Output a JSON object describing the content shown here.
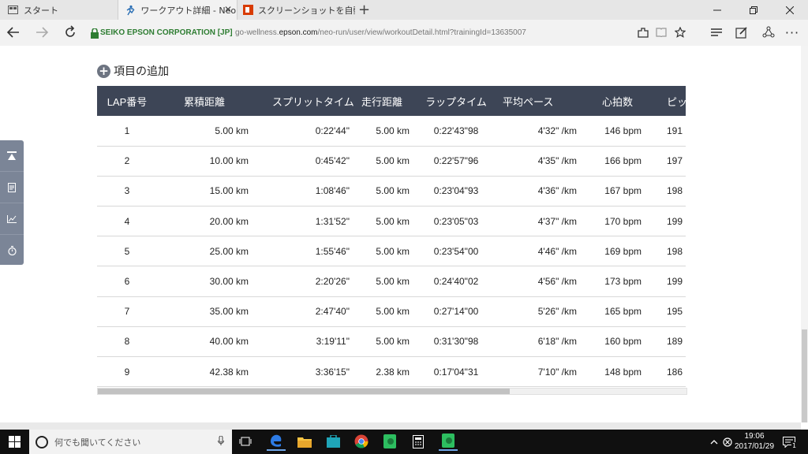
{
  "browser": {
    "tabs": [
      {
        "label": "スタート"
      },
      {
        "label": "ワークアウト詳細 - NeoRu"
      },
      {
        "label": "スクリーンショットを自動的に On"
      }
    ],
    "new_tab_symbol": "+",
    "tab_close_symbol": "✕",
    "address": {
      "security_label": "SEIKO EPSON CORPORATION [JP]",
      "url_prefix": "go-wellness.",
      "url_domain": "epson.com",
      "url_path": "/neo-run/user/view/workoutDetail.html?trainingId=13635007"
    }
  },
  "page": {
    "add_field_label": "項目の追加",
    "table": {
      "columns": [
        "LAP番号",
        "累積距離",
        "スプリットタイム",
        "走行距離",
        "ラップタイム",
        "平均ペース",
        "心拍数",
        "ピッチ"
      ],
      "rows": [
        [
          "1",
          "5.00 km",
          "0:22'44\"",
          "5.00 km",
          "0:22'43\"98",
          "4'32\" /km",
          "146 bpm",
          "191"
        ],
        [
          "2",
          "10.00 km",
          "0:45'42\"",
          "5.00 km",
          "0:22'57\"96",
          "4'35\" /km",
          "166 bpm",
          "197"
        ],
        [
          "3",
          "15.00 km",
          "1:08'46\"",
          "5.00 km",
          "0:23'04\"93",
          "4'36\" /km",
          "167 bpm",
          "198"
        ],
        [
          "4",
          "20.00 km",
          "1:31'52\"",
          "5.00 km",
          "0:23'05\"03",
          "4'37\" /km",
          "170 bpm",
          "199"
        ],
        [
          "5",
          "25.00 km",
          "1:55'46\"",
          "5.00 km",
          "0:23'54\"00",
          "4'46\" /km",
          "169 bpm",
          "198"
        ],
        [
          "6",
          "30.00 km",
          "2:20'26\"",
          "5.00 km",
          "0:24'40\"02",
          "4'56\" /km",
          "173 bpm",
          "199"
        ],
        [
          "7",
          "35.00 km",
          "2:47'40\"",
          "5.00 km",
          "0:27'14\"00",
          "5'26\" /km",
          "165 bpm",
          "195"
        ],
        [
          "8",
          "40.00 km",
          "3:19'11\"",
          "5.00 km",
          "0:31'30\"98",
          "6'18\" /km",
          "160 bpm",
          "189"
        ],
        [
          "9",
          "42.38 km",
          "3:36'15\"",
          "2.38 km",
          "0:17'04\"31",
          "7'10\" /km",
          "148 bpm",
          "186"
        ]
      ]
    }
  },
  "taskbar": {
    "search_placeholder": "何でも聞いてください",
    "time": "19:06",
    "date": "2017/01/29",
    "notification_count": "1"
  },
  "colors": {
    "table_header_bg": "#3d4556",
    "sidebar_bg": "#7b8597",
    "secure_green": "#2e7d32"
  }
}
